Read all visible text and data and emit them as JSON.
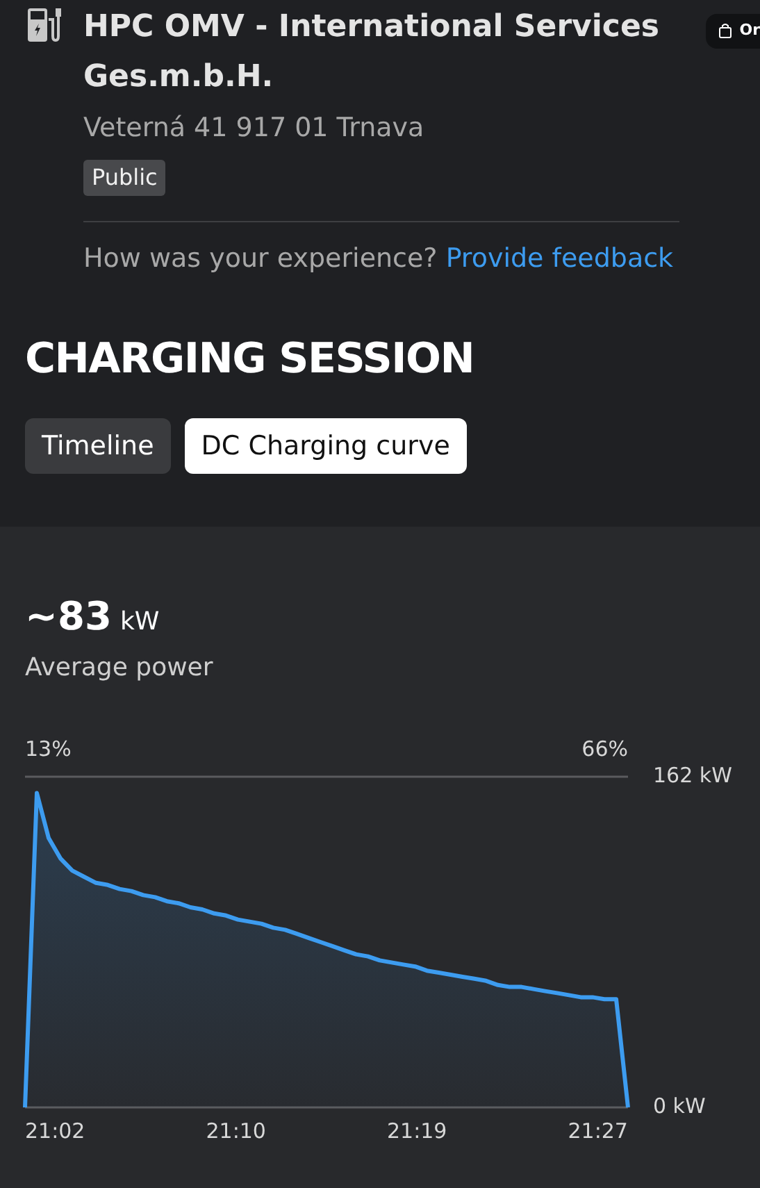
{
  "station": {
    "name": "HPC OMV - International Services Ges.m.b.H.",
    "address": "Veterná 41 917 01 Trnava",
    "badge": "Public"
  },
  "floating_button": {
    "label": "Or"
  },
  "feedback": {
    "question": "How was your experience?",
    "link": "Provide feedback"
  },
  "section_title": "CHARGING SESSION",
  "tabs": [
    {
      "label": "Timeline",
      "selected": false
    },
    {
      "label": "DC Charging curve",
      "selected": true
    }
  ],
  "summary": {
    "prefix": "~",
    "value": "83",
    "unit": "kW",
    "label": "Average power"
  },
  "chart": {
    "soc_start": "13%",
    "soc_end": "66%",
    "time_labels": [
      "21:02",
      "21:10",
      "21:19",
      "21:27"
    ],
    "chart_data": {
      "type": "area",
      "categories": [
        null,
        null,
        null,
        null,
        null,
        null,
        null,
        null,
        null,
        null,
        null,
        null,
        null,
        null,
        null,
        null,
        null,
        null,
        null,
        null,
        null,
        null,
        null,
        null,
        null,
        null,
        null,
        null,
        null,
        null,
        null,
        null,
        null,
        null,
        null,
        null,
        null,
        null,
        null,
        null,
        null,
        null,
        null,
        null,
        null,
        null,
        null,
        null,
        null,
        null,
        null,
        null
      ],
      "series": [
        {
          "color": "#3d9cf0",
          "values": [
            0,
            154,
            132,
            122,
            116,
            113,
            110,
            109,
            107,
            106,
            104,
            103,
            101,
            100,
            98,
            97,
            95,
            94,
            92,
            91,
            90,
            88,
            87,
            85,
            83,
            81,
            79,
            77,
            75,
            74,
            72,
            71,
            70,
            69,
            67,
            66,
            65,
            64,
            63,
            62,
            60,
            59,
            59,
            58,
            57,
            56,
            55,
            54,
            54,
            53,
            53,
            0
          ]
        }
      ],
      "ylim": [
        0,
        162
      ],
      "yticks": [
        {
          "value": 162,
          "label": "162 kW"
        },
        {
          "value": 0,
          "label": "0 kW"
        }
      ]
    }
  }
}
